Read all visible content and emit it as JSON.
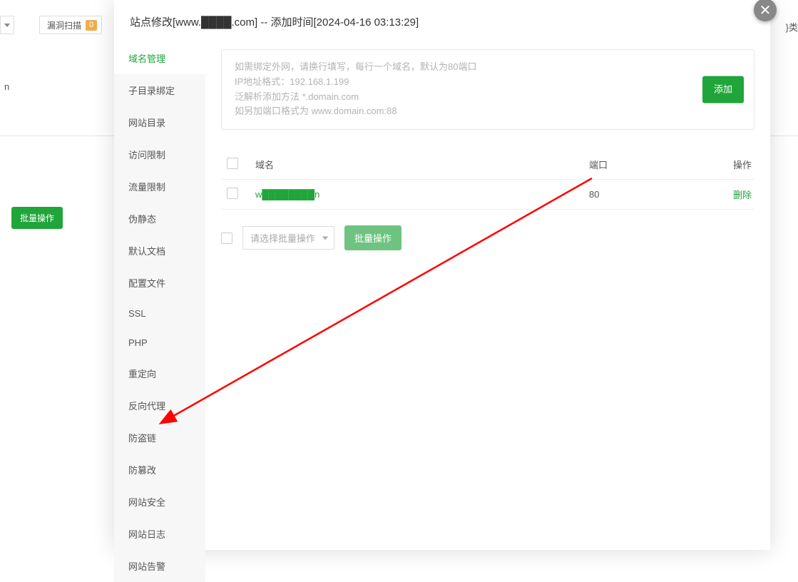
{
  "bg": {
    "scan_label": "漏洞扫描",
    "scan_badge": "0",
    "category_text": "}类",
    "letter": "n",
    "bulk_label": "批量操作"
  },
  "modal": {
    "title": "站点修改[www.████.com]  --  添加时间[2024-04-16 03:13:29]"
  },
  "sidebar": {
    "items": [
      "域名管理",
      "子目录绑定",
      "网站目录",
      "访问限制",
      "流量限制",
      "伪静态",
      "默认文档",
      "配置文件",
      "SSL",
      "PHP",
      "重定向",
      "反向代理",
      "防盗链",
      "防篡改",
      "网站安全",
      "网站日志",
      "网站告警"
    ]
  },
  "hint": {
    "l1": "如需绑定外网，请换行填写，每行一个域名，默认为80端口",
    "l2": "IP地址格式：192.168.1.199",
    "l3": "泛解析添加方法 *.domain.com",
    "l4": "如另加端口格式为 www.domain.com:88"
  },
  "buttons": {
    "add": "添加",
    "batch_select_placeholder": "请选择批量操作",
    "batch_action": "批量操作"
  },
  "table": {
    "headers": {
      "domain": "域名",
      "port": "端口",
      "action": "操作"
    },
    "rows": [
      {
        "domain": "w████████n",
        "port": "80",
        "action": "删除"
      }
    ]
  }
}
